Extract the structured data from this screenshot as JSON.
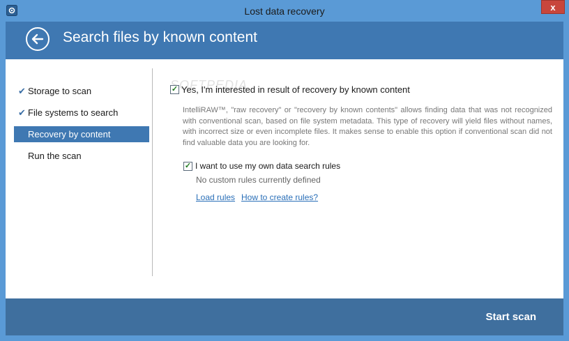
{
  "window": {
    "title": "Lost data recovery",
    "close_label": "x",
    "frame_color": "#5a9ad6"
  },
  "header": {
    "title": "Search files by known content",
    "back_icon": "back-arrow-icon",
    "background": "#3f78b2"
  },
  "sidebar": {
    "items": [
      {
        "label": "Storage to scan",
        "completed": true
      },
      {
        "label": "File systems to search",
        "completed": true
      },
      {
        "label": "Recovery by content",
        "active": true
      },
      {
        "label": "Run the scan"
      }
    ]
  },
  "main": {
    "watermark": "SOFTPEDIA",
    "option1": {
      "label": "Yes, I'm interested in result of recovery by known content",
      "checked": true
    },
    "description": "IntelliRAW™, \"raw recovery\" or \"recovery by known contents\" allows finding data that was not recognized with conventional scan, based on file system metadata. This type of recovery will yield files without names, with incorrect size or even incomplete files. It makes sense to enable this option if conventional scan did not find valuable data you are looking for.",
    "option2": {
      "label": "I want to use my own data search rules",
      "checked": true
    },
    "no_rules_text": "No custom rules currently defined",
    "links": {
      "load_rules": "Load rules",
      "how_to": "How to create rules?"
    }
  },
  "footer": {
    "start_label": "Start scan",
    "background": "#3f6f9e"
  }
}
